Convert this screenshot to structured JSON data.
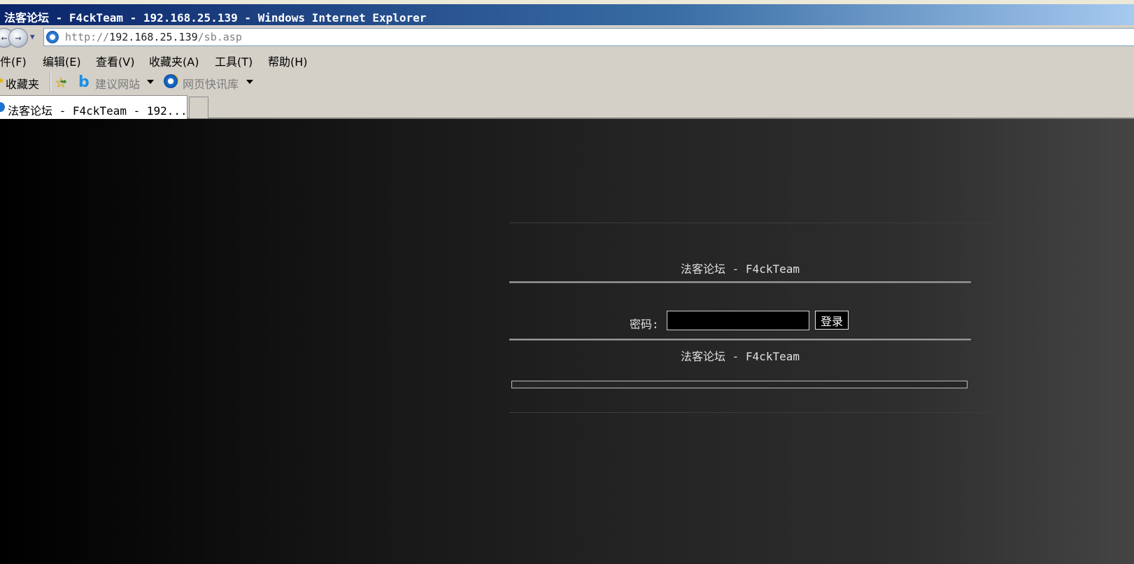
{
  "window": {
    "title": "法客论坛 - F4ckTeam - 192.168.25.139 - Windows Internet Explorer"
  },
  "address_bar": {
    "url_scheme": "http://",
    "url_host": "192.168.25.139",
    "url_path": "/sb.asp"
  },
  "menu": {
    "items": [
      "件(F)",
      "编辑(E)",
      "查看(V)",
      "收藏夹(A)",
      "工具(T)",
      "帮助(H)"
    ]
  },
  "favorites_bar": {
    "label": "收藏夹",
    "items": [
      "建议网站",
      "网页快讯库"
    ]
  },
  "tabs": {
    "active_label": "法客论坛 - F4ckTeam - 192..."
  },
  "page": {
    "header_title": "法客论坛 - F4ckTeam",
    "password_label": "密码:",
    "password_value": "",
    "login_button": "登录",
    "footer_title": "法客论坛 - F4ckTeam"
  }
}
